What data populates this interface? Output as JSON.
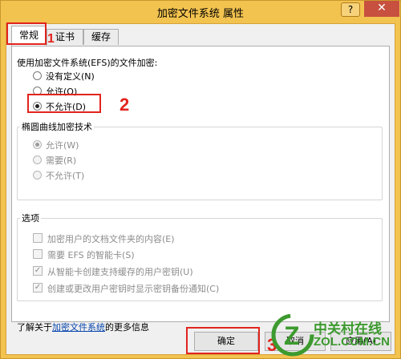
{
  "window": {
    "title": "加密文件系统 属性",
    "help_label": "?",
    "close_label": "✕"
  },
  "tabs": [
    {
      "label": "常规",
      "active": true
    },
    {
      "label": "证书",
      "active": false
    },
    {
      "label": "缓存",
      "active": false
    }
  ],
  "efs": {
    "heading": "使用加密文件系统(EFS)的文件加密:",
    "options": [
      {
        "label": "没有定义(N)",
        "selected": false
      },
      {
        "label": "允许(O)",
        "selected": false
      },
      {
        "label": "不允许(D)",
        "selected": true
      }
    ]
  },
  "ecc": {
    "title": "椭圆曲线加密技术",
    "options": [
      {
        "label": "允许(W)",
        "selected": true,
        "enabled": false
      },
      {
        "label": "需要(R)",
        "selected": false,
        "enabled": false
      },
      {
        "label": "不允许(T)",
        "selected": false,
        "enabled": false
      }
    ]
  },
  "options_group": {
    "title": "选项",
    "items": [
      {
        "label": "加密用户的文档文件夹的内容(E)",
        "checked": false
      },
      {
        "label": "需要 EFS 的智能卡(S)",
        "checked": false
      },
      {
        "label": "从智能卡创建支持缓存的用户密钥(U)",
        "checked": true
      },
      {
        "label": "创建或更改用户密钥时显示密钥备份通知(C)",
        "checked": true
      }
    ]
  },
  "info": {
    "prefix": "了解关于",
    "link": "加密文件系统",
    "suffix": "的更多信息"
  },
  "buttons": {
    "ok": "确定",
    "cancel": "取消",
    "apply": "应用(A)"
  },
  "annotations": {
    "marker_1": "1",
    "marker_2": "2",
    "marker_3": "3",
    "color": "#e2241d"
  },
  "watermark": {
    "cn": "中关村在线",
    "en": "ZOL.COM.CN",
    "color": "#3c9a2e"
  }
}
